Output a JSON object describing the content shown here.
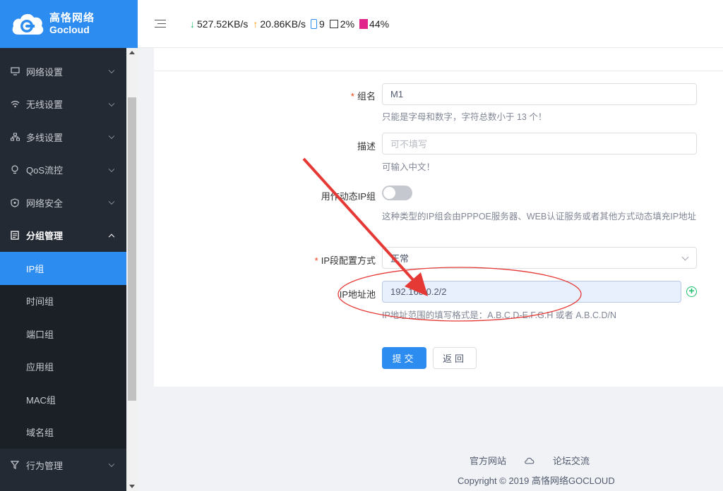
{
  "brand": {
    "cn": "高恪网络",
    "en": "Gocloud"
  },
  "topbar": {
    "download": "527.52KB/s",
    "upload": "20.86KB/s",
    "devices": "9",
    "cpu": "2%",
    "memory": "44%"
  },
  "sidebar": {
    "items": [
      {
        "label": "网络设置",
        "icon": "monitor-icon"
      },
      {
        "label": "无线设置",
        "icon": "wifi-icon"
      },
      {
        "label": "多线设置",
        "icon": "network-icon"
      },
      {
        "label": "QoS流控",
        "icon": "bulb-icon"
      },
      {
        "label": "网络安全",
        "icon": "shield-icon"
      },
      {
        "label": "分组管理",
        "icon": "group-icon"
      }
    ],
    "sub_items": [
      "IP组",
      "时间组",
      "端口组",
      "应用组",
      "MAC组",
      "域名组"
    ],
    "active_sub": "IP组",
    "bottom_item": {
      "label": "行为管理",
      "icon": "filter-icon"
    }
  },
  "form": {
    "name_label": "组名",
    "name_value": "M1",
    "name_hint": "只能是字母和数字，字符总数小于 13 个！",
    "desc_label": "描述",
    "desc_placeholder": "可不填写",
    "desc_hint": "可输入中文！",
    "dynamic_label": "用作动态IP组",
    "dynamic_hint": "这种类型的IP组会由PPPOE服务器、WEB认证服务或者其他方式动态填充IP地址",
    "mode_label": "IP段配置方式",
    "mode_value": "正常",
    "pool_label": "IP地址池",
    "pool_value": "192.168.0.2/2",
    "pool_hint": "IP地址范围的填写格式是：A.B.C.D-E.F.G.H 或者 A.B.C.D/N",
    "submit": "提交",
    "back": "返回"
  },
  "footer": {
    "official_site": "官方网站",
    "forum": "论坛交流",
    "copyright": "Copyright © 2019 高恪网络GOCLOUD"
  },
  "colors": {
    "primary": "#2d8cf0",
    "sidebar_bg": "#242a33",
    "required": "#ed4014",
    "annotation": "#e53935",
    "success": "#19be6b"
  }
}
